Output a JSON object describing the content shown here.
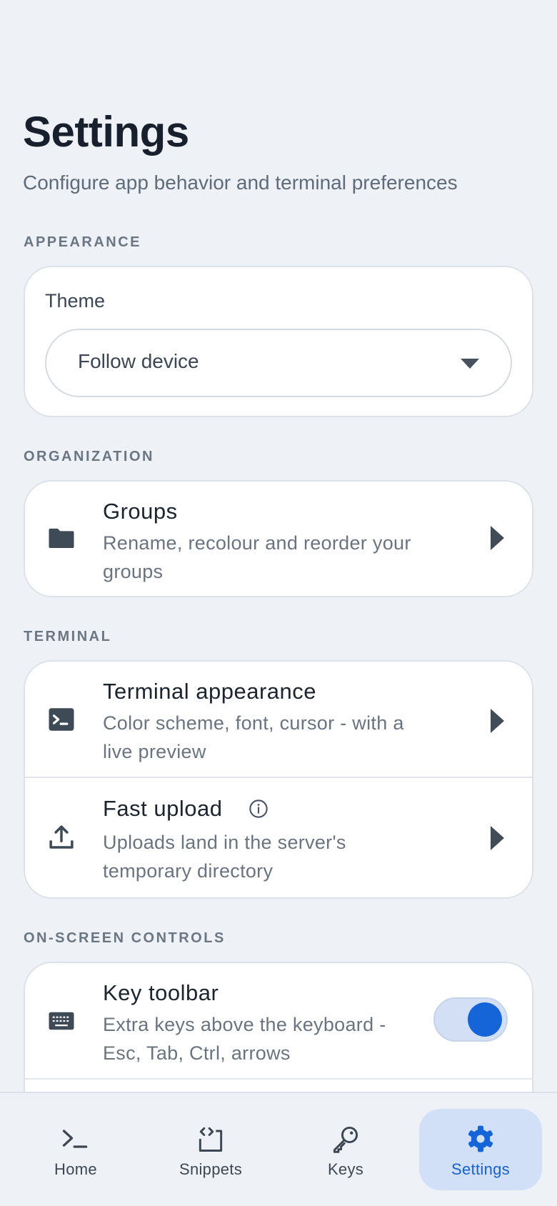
{
  "header": {
    "title": "Settings",
    "subtitle": "Configure app behavior and terminal preferences"
  },
  "sections": {
    "appearance": {
      "label": "APPEARANCE",
      "theme_label": "Theme",
      "theme_value": "Follow device"
    },
    "organization": {
      "label": "ORGANIZATION",
      "groups": {
        "icon": "folder-icon",
        "title": "Groups",
        "description": "Rename, recolour and reorder your groups"
      }
    },
    "terminal": {
      "label": "TERMINAL",
      "appearance": {
        "icon": "terminal-icon",
        "title": "Terminal appearance",
        "description": "Color scheme, font, cursor - with a live preview"
      },
      "fast_upload": {
        "icon": "upload-icon",
        "title": "Fast upload",
        "info_icon": "info-icon",
        "description": "Uploads land in the server's temporary directory"
      }
    },
    "on_screen_controls": {
      "label": "ON-SCREEN CONTROLS",
      "key_toolbar": {
        "icon": "keyboard-icon",
        "title": "Key toolbar",
        "description": "Extra keys above the keyboard - Esc, Tab, Ctrl, arrows",
        "enabled": true
      }
    }
  },
  "bottom_nav": {
    "items": [
      {
        "label": "Home",
        "icon": "terminal-prompt-icon",
        "active": false
      },
      {
        "label": "Snippets",
        "icon": "code-snippet-icon",
        "active": false
      },
      {
        "label": "Keys",
        "icon": "key-icon",
        "active": false
      },
      {
        "label": "Settings",
        "icon": "gear-icon",
        "active": true
      }
    ]
  },
  "colors": {
    "background": "#eef1f6",
    "card": "#ffffff",
    "accent": "#1565d8",
    "active_nav_bg": "#d1e0f7",
    "toggle_track": "#d3dff5"
  }
}
